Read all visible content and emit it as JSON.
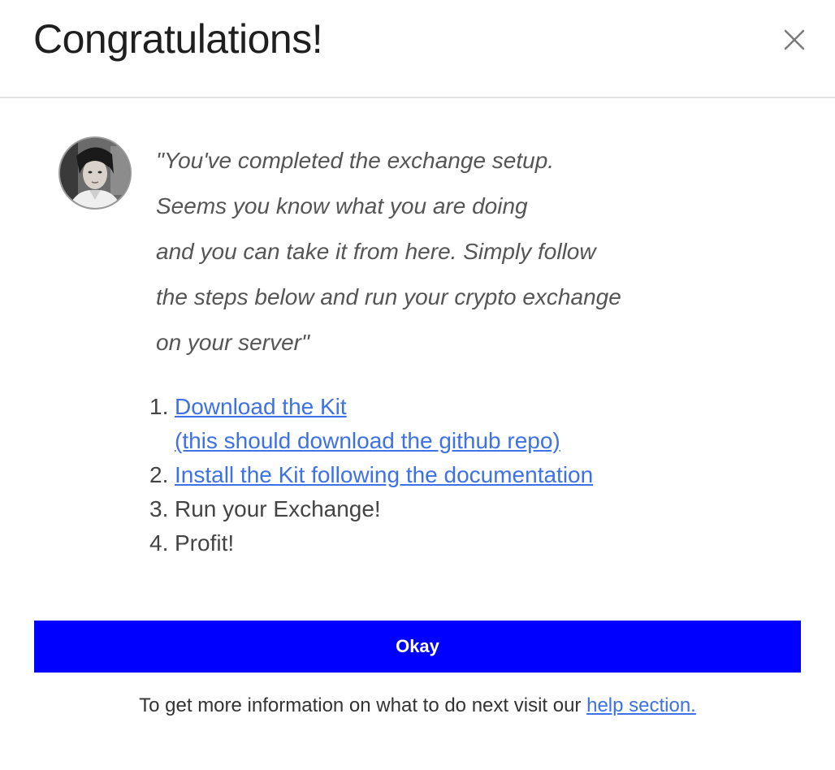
{
  "header": {
    "title": "Congratulations!"
  },
  "avatar": {
    "icon": "user-photo"
  },
  "quote": {
    "lines": [
      "\"You've completed the exchange setup.",
      "Seems you know what you are doing",
      "and you can take it from here. Simply follow",
      "the steps below and run your crypto exchange",
      "on your server\""
    ]
  },
  "steps": [
    {
      "number": "1.",
      "link_line_1": "Download the Kit",
      "link_line_2": "(this should download the github repo)"
    },
    {
      "number": "2.",
      "link": "Install the Kit following the documentation"
    },
    {
      "number": "3.",
      "text": "Run your Exchange!"
    },
    {
      "number": "4.",
      "text": "Profit!"
    }
  ],
  "actions": {
    "okay_label": "Okay"
  },
  "footer": {
    "text": "To get more information on what to do next visit our ",
    "link": "help section."
  },
  "colors": {
    "primary_button": "#0000ff",
    "link": "#3c71e8",
    "quote_text": "#555555",
    "divider": "#e4e4e4"
  }
}
